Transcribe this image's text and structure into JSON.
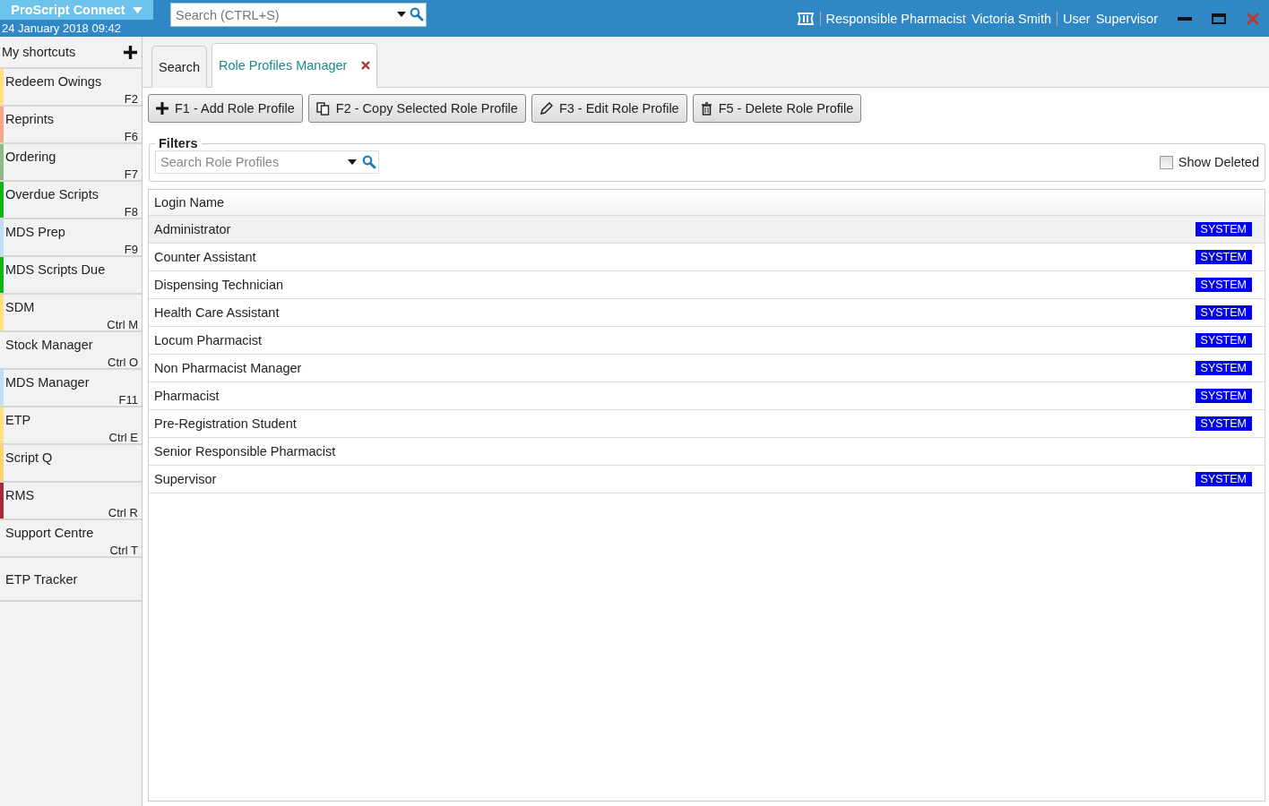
{
  "header": {
    "app_name": "ProScript Connect",
    "date_time": "24 January 2018 09:42",
    "search": {
      "placeholder": "Search (CTRL+S)"
    },
    "responsible_label": "Responsible Pharmacist",
    "responsible_name": "Victoria Smith",
    "user_label": "User",
    "user_name": "Supervisor"
  },
  "sidebar": {
    "title": "My shortcuts",
    "items": [
      {
        "label": "Redeem Owings",
        "shortcut": "F2",
        "color": "#ffe082"
      },
      {
        "label": "Reprints",
        "shortcut": "F6",
        "color": "#f7a686"
      },
      {
        "label": "Ordering",
        "shortcut": "F7",
        "color": "#8fb98b"
      },
      {
        "label": "Overdue Scripts",
        "shortcut": "F8",
        "color": "#11b31b"
      },
      {
        "label": "MDS Prep",
        "shortcut": "F9",
        "color": "#c6def4"
      },
      {
        "label": "MDS Scripts Due",
        "color": "#11b31b"
      },
      {
        "label": "SDM",
        "shortcut": "Ctrl M",
        "color": "#ffe082"
      },
      {
        "label": "Stock Manager",
        "shortcut": "Ctrl O"
      },
      {
        "label": "MDS Manager",
        "shortcut": "F11",
        "color": "#c6def4"
      },
      {
        "label": "ETP",
        "shortcut": "Ctrl E",
        "color": "#ffe082"
      },
      {
        "label": "Script Q",
        "color": "#ffd36e"
      },
      {
        "label": "RMS",
        "shortcut": "Ctrl R",
        "color": "#a52a3a"
      },
      {
        "label": "Support Centre",
        "shortcut": "Ctrl T"
      },
      {
        "label": "ETP Tracker"
      }
    ]
  },
  "tabs": [
    {
      "label": "Search",
      "selected": false,
      "closable": false
    },
    {
      "label": "Role Profiles Manager",
      "selected": true,
      "closable": true
    }
  ],
  "toolbar": [
    {
      "label": "F1 - Add Role Profile",
      "kind": "add"
    },
    {
      "label": "F2 - Copy Selected Role Profile",
      "kind": "copy"
    },
    {
      "label": "F3 - Edit Role Profile",
      "kind": "edit"
    },
    {
      "label": "F5 - Delete Role Profile",
      "kind": "delete"
    }
  ],
  "filters": {
    "title": "Filters",
    "search": {
      "placeholder": "Search Role Profiles"
    },
    "show_deleted": {
      "label": "Show Deleted",
      "checked": false
    }
  },
  "table": {
    "columns": [
      "Login Name"
    ],
    "rows": [
      {
        "name": "Administrator",
        "badge": "SYSTEM",
        "selected": true
      },
      {
        "name": "Counter Assistant",
        "badge": "SYSTEM",
        "selected": false
      },
      {
        "name": "Dispensing Technician",
        "badge": "SYSTEM",
        "selected": false
      },
      {
        "name": "Health Care Assistant",
        "badge": "SYSTEM",
        "selected": false
      },
      {
        "name": "Locum Pharmacist",
        "badge": "SYSTEM",
        "selected": false
      },
      {
        "name": "Non Pharmacist Manager",
        "badge": "SYSTEM",
        "selected": false
      },
      {
        "name": "Pharmacist",
        "badge": "SYSTEM",
        "selected": false
      },
      {
        "name": "Pre-Registration Student",
        "badge": "SYSTEM",
        "selected": false
      },
      {
        "name": "Senior Responsible Pharmacist",
        "selected": false
      },
      {
        "name": "Supervisor",
        "badge": "SYSTEM",
        "selected": false
      }
    ]
  }
}
